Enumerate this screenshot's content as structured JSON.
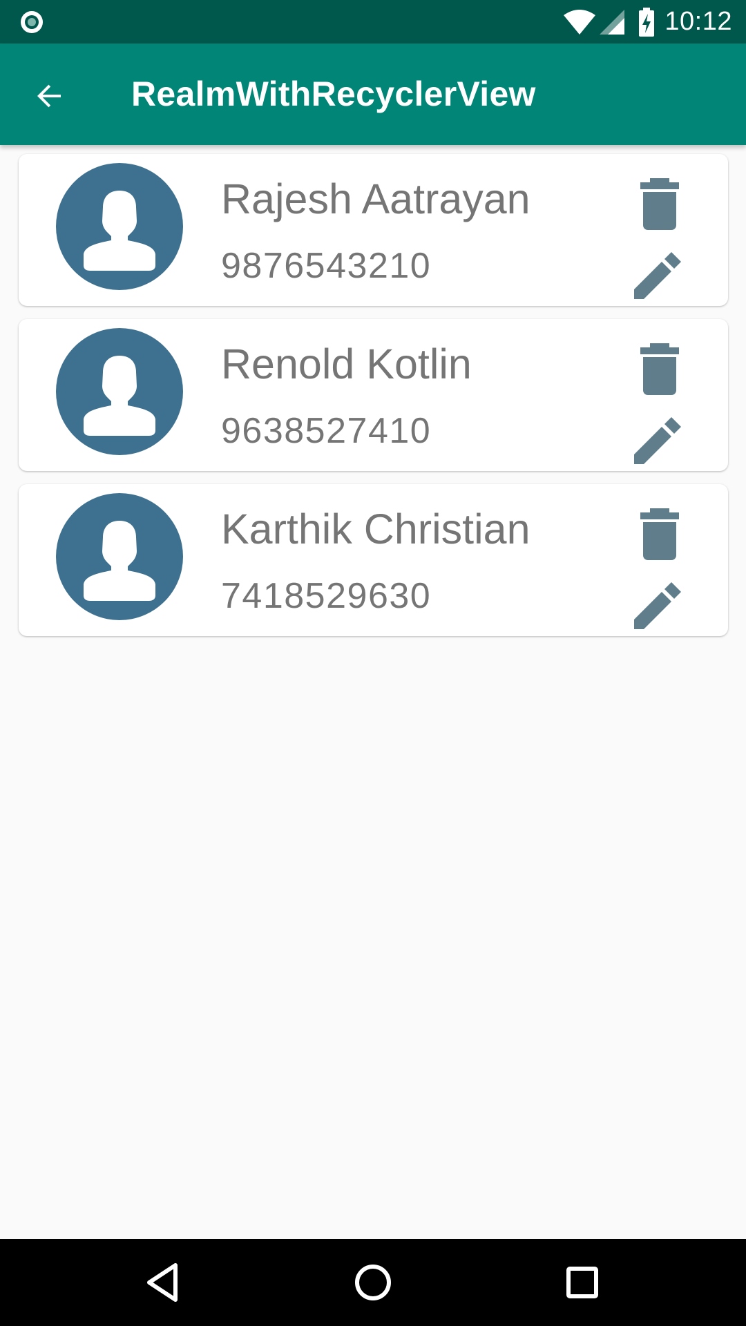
{
  "status_bar": {
    "time": "10:12",
    "left_icon": "notification-dot-icon",
    "icons": [
      "wifi-icon",
      "signal-icon",
      "battery-charging-icon"
    ]
  },
  "app_bar": {
    "title": "RealmWithRecyclerView",
    "back_icon": "arrow-back-icon",
    "background": "#008577",
    "status_bar_background": "#00574b"
  },
  "contacts": [
    {
      "name": "Rajesh Aatrayan",
      "phone": "9876543210"
    },
    {
      "name": "Renold Kotlin",
      "phone": "9638527410"
    },
    {
      "name": "Karthik Christian",
      "phone": "7418529630"
    }
  ],
  "card_actions": {
    "delete_icon": "trash-icon",
    "edit_icon": "pencil-icon",
    "icon_color": "#607d8b"
  },
  "avatar": {
    "icon": "person-icon",
    "background": "#3e718f"
  },
  "nav_bar": {
    "buttons": [
      "back-triangle-icon",
      "home-circle-icon",
      "recents-square-icon"
    ]
  }
}
